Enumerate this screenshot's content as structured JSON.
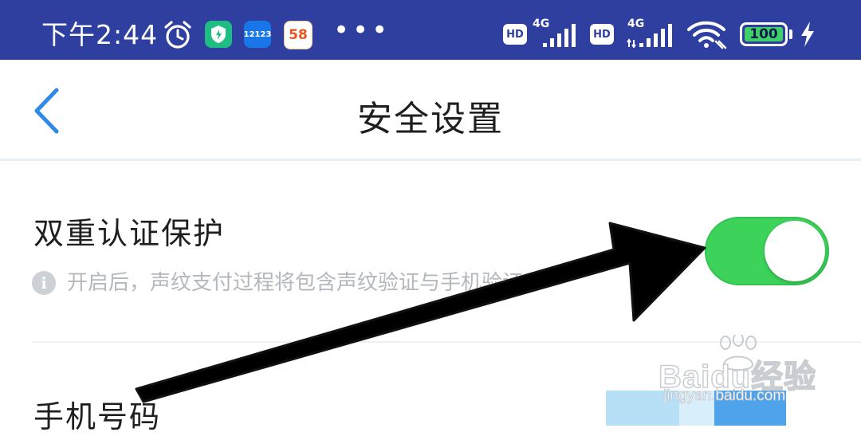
{
  "status_bar": {
    "time": "下午2:44",
    "app_badge_12123": "12123",
    "app_badge_58": "58",
    "more": "•••",
    "hd1": "HD",
    "net1": "4G",
    "hd2": "HD",
    "net2": "4G",
    "battery_level": "100",
    "bg_color": "#2f3fa0"
  },
  "header": {
    "title": "安全设置",
    "back_icon": "chevron-left-icon"
  },
  "settings": {
    "two_factor": {
      "label": "双重认证保护",
      "hint": "开启后，声纹支付过程将包含声纹验证与手机验证",
      "enabled": true,
      "toggle_color": "#3dd35b"
    },
    "phone": {
      "label": "手机号码"
    }
  },
  "watermark": {
    "brand": "Baidu经验",
    "url": "jingyan.baidu.com"
  }
}
